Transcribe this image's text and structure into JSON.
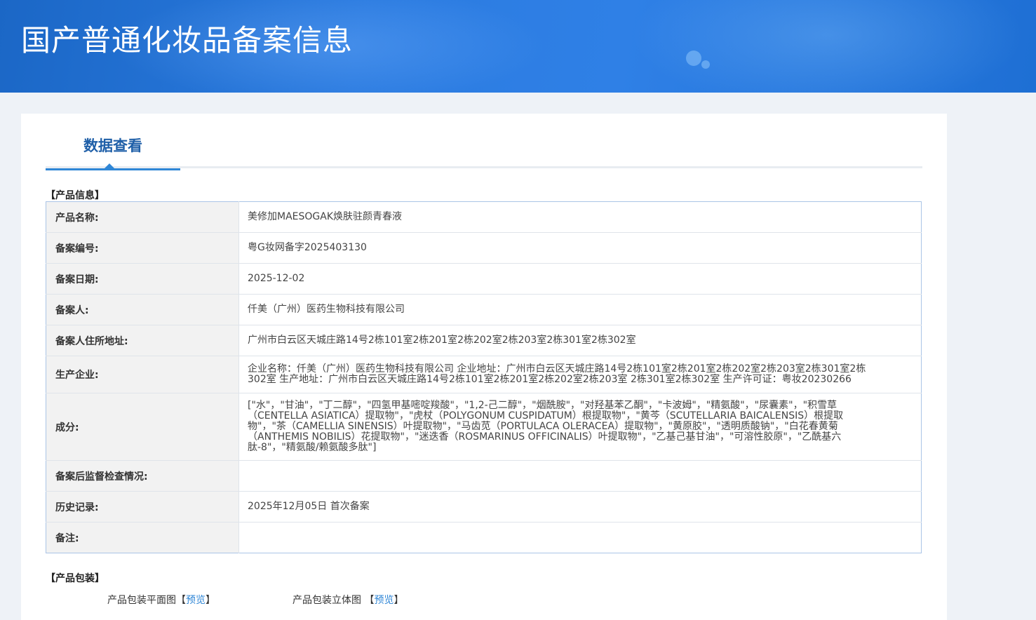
{
  "header": {
    "title": "国产普通化妆品备案信息"
  },
  "tabs": [
    {
      "label": "数据查看",
      "active": true
    }
  ],
  "product_info": {
    "section_title": "【产品信息】",
    "rows": [
      {
        "label": "产品名称:",
        "value": "美修加MAESOGAK焕肤驻颜青春液"
      },
      {
        "label": "备案编号:",
        "value": "粤G妆网备字2025403130"
      },
      {
        "label": "备案日期:",
        "value": "2025-12-02"
      },
      {
        "label": "备案人:",
        "value": "仟美（广州）医药生物科技有限公司"
      },
      {
        "label": "备案人住所地址:",
        "value": "广州市白云区天城庄路14号2栋101室2栋201室2栋202室2栋203室2栋301室2栋302室"
      },
      {
        "label": "生产企业:",
        "value": "企业名称：仟美（广州）医药生物科技有限公司 企业地址：广州市白云区天城庄路14号2栋101室2栋201室2栋202室2栋203室2栋301室2栋302室 生产地址：广州市白云区天城庄路14号2栋101室2栋201室2栋202室2栋203室 2栋301室2栋302室 生产许可证：粤妆20230266"
      },
      {
        "label": "成分:",
        "value": "[\"水\"，\"甘油\"，\"丁二醇\"，\"四氢甲基嘧啶羧酸\"，\"1,2-己二醇\"，\"烟酰胺\"，\"对羟基苯乙酮\"，\"卡波姆\"，\"精氨酸\"，\"尿囊素\"，\"积雪草（CENTELLA ASIATICA）提取物\"，\"虎杖（POLYGONUM CUSPIDATUM）根提取物\"，\"黄芩（SCUTELLARIA BAICALENSIS）根提取物\"，\"茶（CAMELLIA SINENSIS）叶提取物\"，\"马齿苋（PORTULACA OLERACEA）提取物\"，\"黄原胶\"，\"透明质酸钠\"，\"白花春黄菊（ANTHEMIS NOBILIS）花提取物\"，\"迷迭香（ROSMARINUS OFFICINALIS）叶提取物\"，\"乙基己基甘油\"，\"可溶性胶原\"，\"乙酰基六肽-8\"，\"精氨酸/赖氨酸多肽\"]"
      },
      {
        "label": "备案后监督检查情况:",
        "value": ""
      },
      {
        "label": "历史记录:",
        "value": "2025年12月05日 首次备案"
      },
      {
        "label": "备注:",
        "value": ""
      }
    ]
  },
  "packaging": {
    "section_title": "【产品包装】",
    "flat_label": "产品包装平面图",
    "solid_label": "产品包装立体图",
    "preview_link": "预览",
    "bracket_open": "【",
    "bracket_close": "】"
  },
  "colors": {
    "banner": "#2b7be0",
    "tab_active": "#1f5fa8",
    "link": "#2f86d6",
    "label_bg": "#f2f2f2",
    "table_border": "#aac4e6"
  }
}
